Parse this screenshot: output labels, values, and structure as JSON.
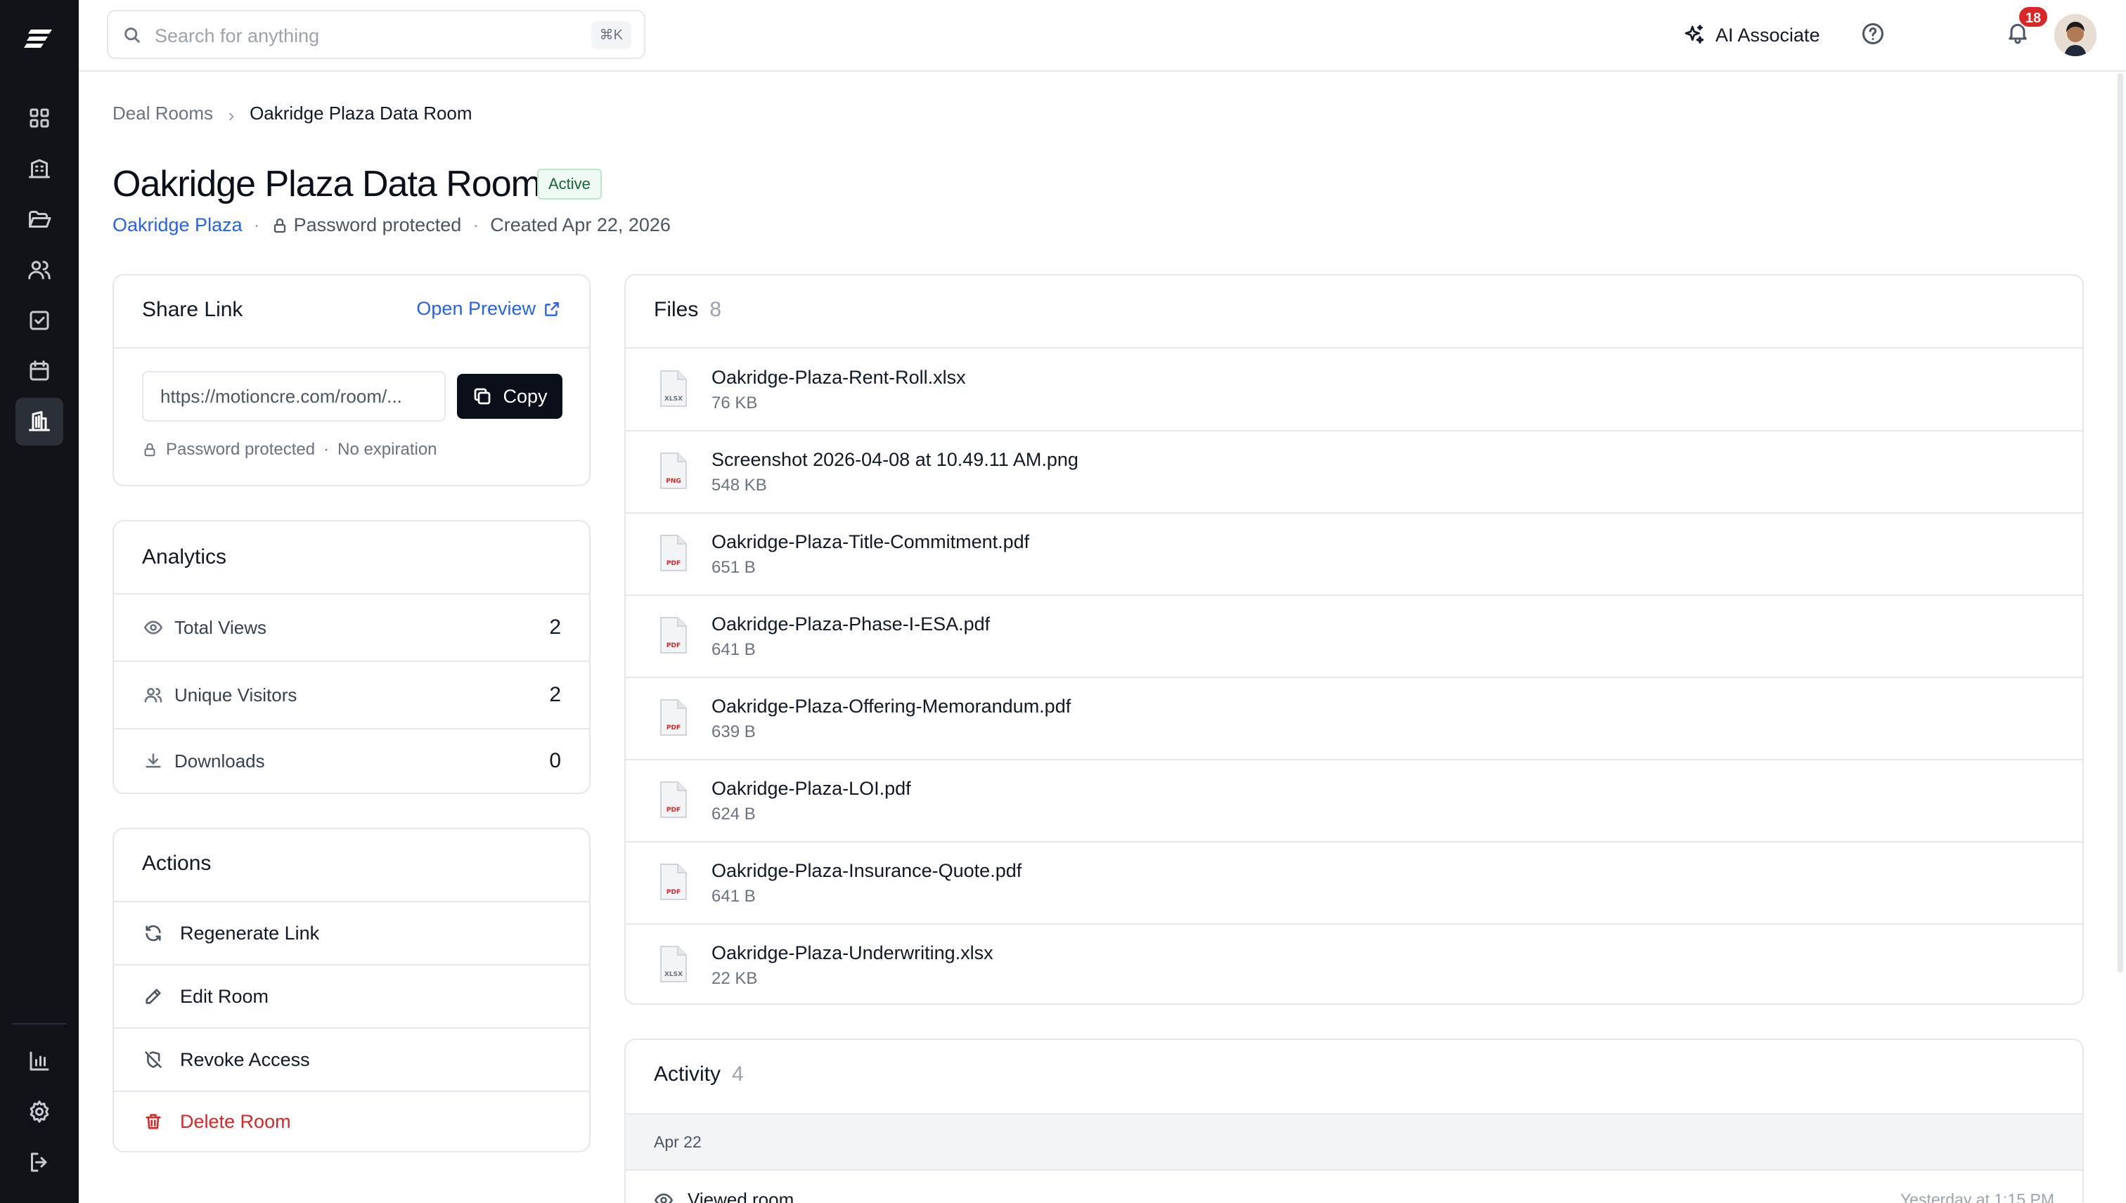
{
  "search": {
    "placeholder": "Search for anything",
    "shortcut": "⌘K"
  },
  "topbar": {
    "ai_label": "AI Associate",
    "notification_count": "18"
  },
  "breadcrumb": {
    "parent": "Deal Rooms",
    "current": "Oakridge Plaza Data Room"
  },
  "page": {
    "title": "Oakridge Plaza Data Room",
    "status": "Active",
    "property_link": "Oakridge Plaza",
    "protection": "Password protected",
    "created": "Created Apr 22, 2026"
  },
  "share": {
    "title": "Share Link",
    "open_preview": "Open Preview",
    "url": "https://motioncre.com/room/...",
    "copy_label": "Copy",
    "protection": "Password protected",
    "separator": "·",
    "expiration": "No expiration"
  },
  "analytics": {
    "title": "Analytics",
    "rows": [
      {
        "label": "Total Views",
        "value": "2",
        "icon": "eye-icon"
      },
      {
        "label": "Unique Visitors",
        "value": "2",
        "icon": "users-icon"
      },
      {
        "label": "Downloads",
        "value": "0",
        "icon": "download-icon"
      }
    ]
  },
  "actions": {
    "title": "Actions",
    "items": [
      {
        "label": "Regenerate Link",
        "icon": "refresh-icon"
      },
      {
        "label": "Edit Room",
        "icon": "pencil-icon"
      },
      {
        "label": "Revoke Access",
        "icon": "shield-off-icon"
      },
      {
        "label": "Delete Room",
        "icon": "trash-icon",
        "color": "#dc2626"
      }
    ]
  },
  "files": {
    "title": "Files",
    "count": "8",
    "items": [
      {
        "name": "Oakridge-Plaza-Rent-Roll.xlsx",
        "size": "76 KB",
        "type": "XLSX"
      },
      {
        "name": "Screenshot 2026-04-08 at 10.49.11 AM.png",
        "size": "548 KB",
        "type": "PNG"
      },
      {
        "name": "Oakridge-Plaza-Title-Commitment.pdf",
        "size": "651 B",
        "type": "PDF"
      },
      {
        "name": "Oakridge-Plaza-Phase-I-ESA.pdf",
        "size": "641 B",
        "type": "PDF"
      },
      {
        "name": "Oakridge-Plaza-Offering-Memorandum.pdf",
        "size": "639 B",
        "type": "PDF"
      },
      {
        "name": "Oakridge-Plaza-LOI.pdf",
        "size": "624 B",
        "type": "PDF"
      },
      {
        "name": "Oakridge-Plaza-Insurance-Quote.pdf",
        "size": "641 B",
        "type": "PDF"
      },
      {
        "name": "Oakridge-Plaza-Underwriting.xlsx",
        "size": "22 KB",
        "type": "XLSX"
      }
    ]
  },
  "activity": {
    "title": "Activity",
    "count": "4",
    "date_group": "Apr 22",
    "first_item": {
      "label": "Viewed room",
      "time": "Yesterday at 1:15 PM"
    }
  },
  "colors": {
    "accent": "#2563eb",
    "danger": "#dc2626",
    "sidebar": "#111318",
    "success": "#166534"
  }
}
